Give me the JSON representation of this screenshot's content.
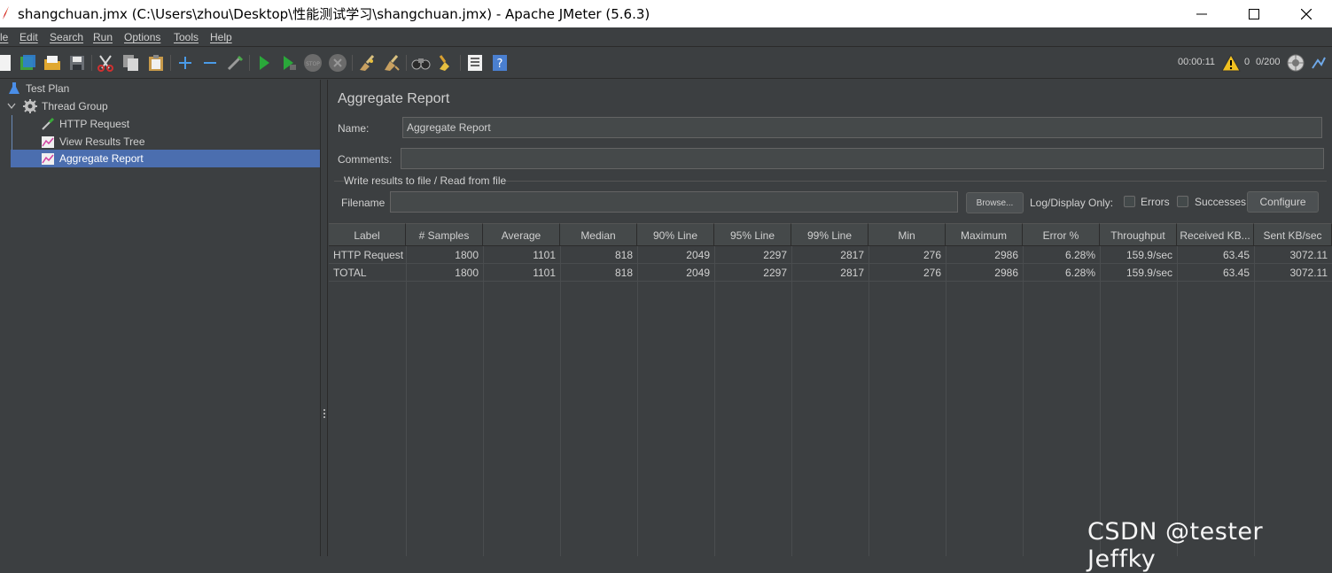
{
  "window": {
    "title": "shangchuan.jmx (C:\\Users\\zhou\\Desktop\\性能测试学习\\shangchuan.jmx) - Apache JMeter (5.6.3)"
  },
  "menu": [
    "le",
    "Edit",
    "Search",
    "Run",
    "Options",
    "Tools",
    "Help"
  ],
  "status": {
    "elapsed": "00:00:11",
    "errors": "0",
    "threads": "0/200"
  },
  "tree": {
    "test_plan": "Test Plan",
    "thread_group": "Thread Group",
    "http_request": "HTTP Request",
    "view_results_tree": "View Results Tree",
    "aggregate_report": "Aggregate Report"
  },
  "panel": {
    "heading": "Aggregate Report",
    "name_label": "Name:",
    "name_value": "Aggregate Report",
    "comments_label": "Comments:",
    "comments_value": "",
    "fieldset_legend": "Write results to file / Read from file",
    "filename_label": "Filename",
    "filename_value": "",
    "browse_label": "Browse...",
    "log_display_label": "Log/Display Only:",
    "errors_label": "Errors",
    "successes_label": "Successes",
    "configure_label": "Configure"
  },
  "table": {
    "headers": [
      "Label",
      "# Samples",
      "Average",
      "Median",
      "90% Line",
      "95% Line",
      "99% Line",
      "Min",
      "Maximum",
      "Error %",
      "Throughput",
      "Received KB...",
      "Sent KB/sec"
    ],
    "rows": [
      [
        "HTTP Request",
        "1800",
        "1101",
        "818",
        "2049",
        "2297",
        "2817",
        "276",
        "2986",
        "6.28%",
        "159.9/sec",
        "63.45",
        "3072.11"
      ],
      [
        "TOTAL",
        "1800",
        "1101",
        "818",
        "2049",
        "2297",
        "2817",
        "276",
        "2986",
        "6.28%",
        "159.9/sec",
        "63.45",
        "3072.11"
      ]
    ]
  },
  "watermark": "CSDN @tester Jeffky"
}
